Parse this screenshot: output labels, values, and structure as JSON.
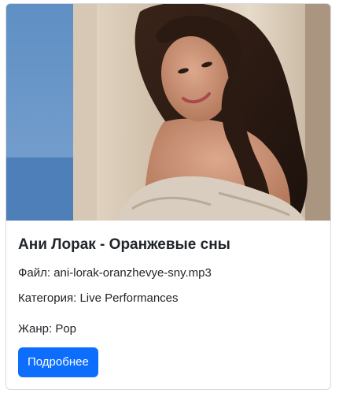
{
  "card": {
    "title": "Ани Лорак - Оранжевые сны",
    "file_label": "Файл:",
    "file_value": "ani-lorak-oranzhevye-sny.mp3",
    "category_label": "Категория:",
    "category_value": "Live Performances",
    "genre_label": "Жанр:",
    "genre_value": "Pop",
    "button_label": "Подробнее"
  },
  "colors": {
    "accent": "#0d6efd",
    "text": "#212529",
    "border": "#d8dadd"
  }
}
